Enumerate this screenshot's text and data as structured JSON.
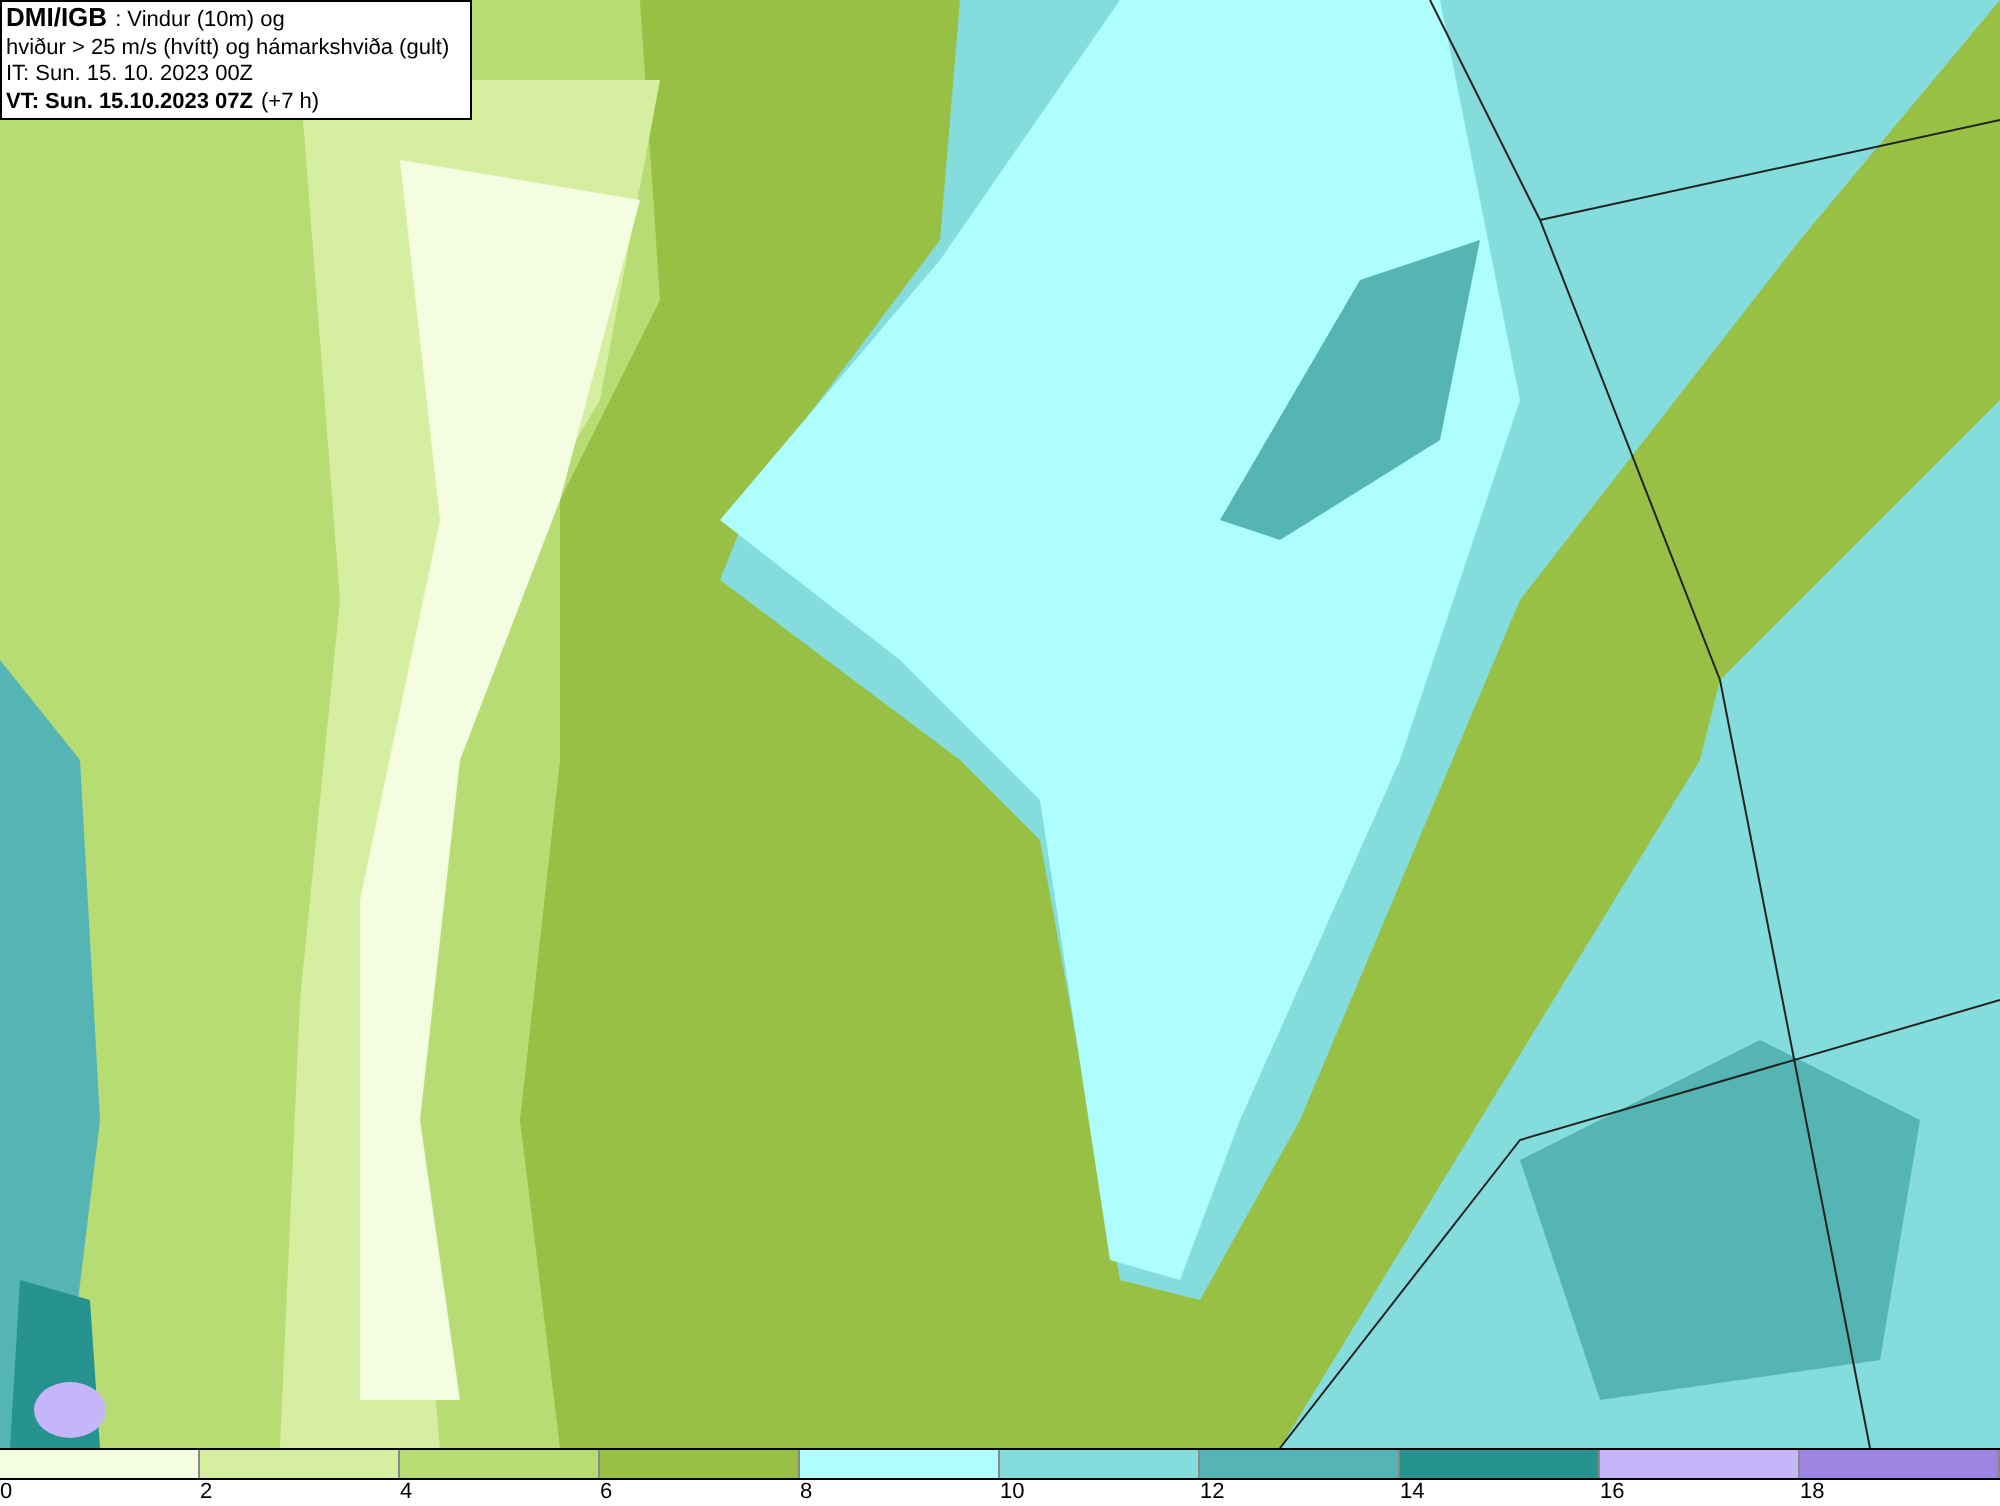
{
  "info_box": {
    "source": "DMI/IGB",
    "title": ": Vindur (10m) og",
    "subtitle": "hviður > 25 m/s (hvítt) og hámarkshviða (gult)",
    "issue_time": "IT: Sun. 15. 10. 2023 00Z",
    "valid_time": "VT: Sun. 15.10.2023 07Z",
    "lead_time": "(+7 h)"
  },
  "legend": [
    {
      "label": "0",
      "color": "#f5fde0"
    },
    {
      "label": "2",
      "color": "#d6eea0"
    },
    {
      "label": "4",
      "color": "#b8dc74"
    },
    {
      "label": "6",
      "color": "#98c044"
    },
    {
      "label": "8",
      "color": "#aefefe"
    },
    {
      "label": "10",
      "color": "#84dcdc"
    },
    {
      "label": "12",
      "color": "#55b4b4"
    },
    {
      "label": "14",
      "color": "#27938f"
    },
    {
      "label": "16",
      "color": "#c4b6f8"
    },
    {
      "label": "18",
      "color": "#9c84e0"
    }
  ]
}
